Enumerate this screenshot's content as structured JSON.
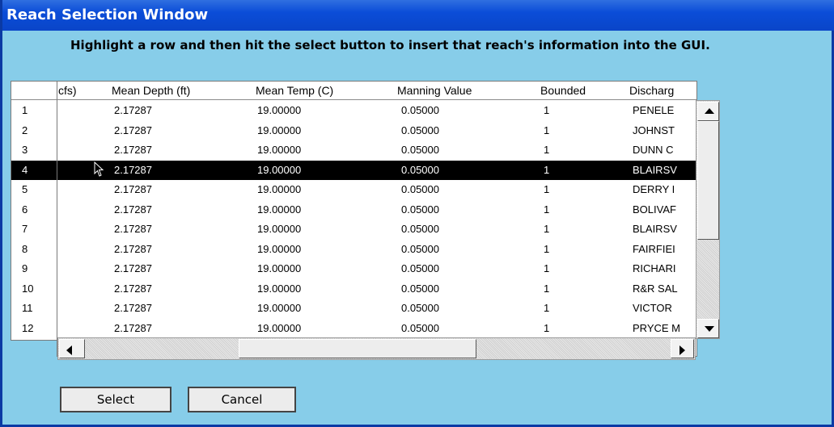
{
  "window": {
    "title": "Reach Selection Window"
  },
  "instruction": "Highlight a row and then hit the select button to insert that reach's information into the GUI.",
  "table": {
    "columns": [
      "cfs)",
      "Mean Depth (ft)",
      "Mean Temp (C)",
      "Manning Value",
      "Bounded",
      "Discharg"
    ],
    "selected_row": 4,
    "row_numbers": [
      "1",
      "2",
      "3",
      "4",
      "5",
      "6",
      "7",
      "8",
      "9",
      "10",
      "11",
      "12"
    ],
    "rows": [
      [
        "2.17287",
        "19.00000",
        "0.05000",
        "1",
        "PENELE"
      ],
      [
        "2.17287",
        "19.00000",
        "0.05000",
        "1",
        "JOHNST"
      ],
      [
        "2.17287",
        "19.00000",
        "0.05000",
        "1",
        "DUNN C"
      ],
      [
        "2.17287",
        "19.00000",
        "0.05000",
        "1",
        "BLAIRSV"
      ],
      [
        "2.17287",
        "19.00000",
        "0.05000",
        "1",
        "DERRY I"
      ],
      [
        "2.17287",
        "19.00000",
        "0.05000",
        "1",
        "BOLIVAF"
      ],
      [
        "2.17287",
        "19.00000",
        "0.05000",
        "1",
        "BLAIRSV"
      ],
      [
        "2.17287",
        "19.00000",
        "0.05000",
        "1",
        "FAIRFIEI"
      ],
      [
        "2.17287",
        "19.00000",
        "0.05000",
        "1",
        "RICHARI"
      ],
      [
        "2.17287",
        "19.00000",
        "0.05000",
        "1",
        "R&R SAL"
      ],
      [
        "2.17287",
        "19.00000",
        "0.05000",
        "1",
        "VICTOR"
      ],
      [
        "2.17287",
        "19.00000",
        "0.05000",
        "1",
        "PRYCE M"
      ]
    ]
  },
  "buttons": {
    "select": "Select",
    "cancel": "Cancel"
  }
}
